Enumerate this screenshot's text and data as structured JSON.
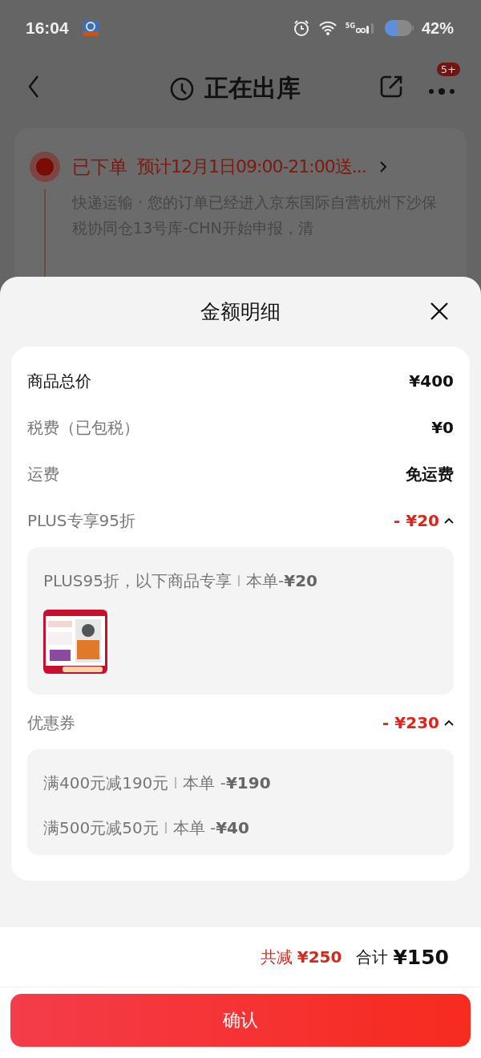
{
  "status_bar": {
    "time": "16:04",
    "network": "5G",
    "battery": "42%"
  },
  "header": {
    "title": "正在出库",
    "badge": "5+"
  },
  "order": {
    "status": "已下单",
    "eta": "预计12月1日09:00-21:00送...",
    "detail": "快递运输 · 您的订单已经进入京东国际自营杭州下沙保税协同仓13号库-CHN开始申报，清"
  },
  "sheet": {
    "title": "金额明细",
    "rows": [
      {
        "kind": "line",
        "label": "商品总价",
        "value": "¥400",
        "muted": false
      },
      {
        "kind": "line",
        "label": "税费（已包税）",
        "value": "¥0",
        "muted": true
      },
      {
        "kind": "line",
        "label": "运费",
        "value": "免运费",
        "muted": true
      },
      {
        "kind": "group",
        "label": "PLUS专享95折",
        "value": "- ¥20",
        "expanded": true,
        "details": [
          {
            "text": "PLUS95折，以下商品专享",
            "amount": "本单-**¥20**"
          }
        ]
      },
      {
        "kind": "group",
        "label": "优惠券",
        "value": "- ¥230",
        "expanded": true,
        "details": [
          {
            "text": "满400元减190元",
            "amount": "本单 -**¥190**"
          },
          {
            "text": "满500元减50元",
            "amount": "本单 -**¥40**"
          }
        ]
      }
    ],
    "saved_label": "共减",
    "saved": "¥250",
    "total_label": "合计",
    "total": "¥150",
    "confirm": "确认"
  }
}
